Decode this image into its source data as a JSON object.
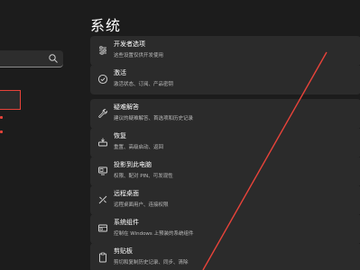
{
  "page": {
    "title": "系统"
  },
  "settings": [
    {
      "title": "开发者选项",
      "subtitle": "这些设置仅供开发使用",
      "icon": "developer-tools-icon"
    },
    {
      "title": "激活",
      "subtitle": "激活状态、订阅、产品密钥",
      "icon": "check-circle-icon"
    },
    {
      "title": "疑难解答",
      "subtitle": "建议的疑难解答、首选项和历史记录",
      "icon": "wrench-icon"
    },
    {
      "title": "恢复",
      "subtitle": "重置、高级启动、返回",
      "icon": "recovery-drive-icon"
    },
    {
      "title": "投影到此电脑",
      "subtitle": "权限、配对 PIN、可发现性",
      "icon": "project-to-pc-icon"
    },
    {
      "title": "远程桌面",
      "subtitle": "远程桌面用户、连接权限",
      "icon": "remote-desktop-icon"
    },
    {
      "title": "系统组件",
      "subtitle": "控制在 Windows 上预装的系统组件",
      "icon": "system-components-icon"
    },
    {
      "title": "剪贴板",
      "subtitle": "剪切和复制历史记录、同步、清除",
      "icon": "clipboard-icon"
    }
  ],
  "colors": {
    "background": "#1c1c1c",
    "card": "#2b2b2b",
    "annotation": "#e8433a"
  }
}
